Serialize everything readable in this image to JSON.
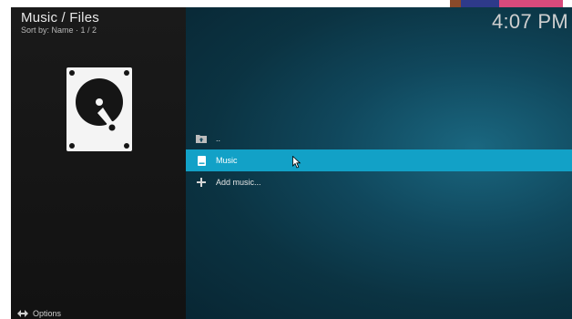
{
  "header": {
    "title": "Music / Files",
    "sort_info": "Sort by: Name  ·  1 / 2",
    "clock": "4:07 PM"
  },
  "thumbnail": {
    "icon": "hard-drive-icon"
  },
  "list": {
    "items": [
      {
        "label": "..",
        "icon": "folder-up-icon"
      },
      {
        "label": "Music",
        "icon": "hard-drive-small-icon",
        "selected": true
      },
      {
        "label": "Add music...",
        "icon": "plus-icon"
      }
    ]
  },
  "footer": {
    "options_label": "Options",
    "options_icon": "options-arrows-icon"
  },
  "colors": {
    "selection": "#12a1c7",
    "panel_left": "#161616",
    "panel_right": "#0e3d50",
    "stripe_brown": "#8a4a2a",
    "stripe_navy": "#2e3a8a",
    "stripe_pink": "#d94a7c"
  }
}
